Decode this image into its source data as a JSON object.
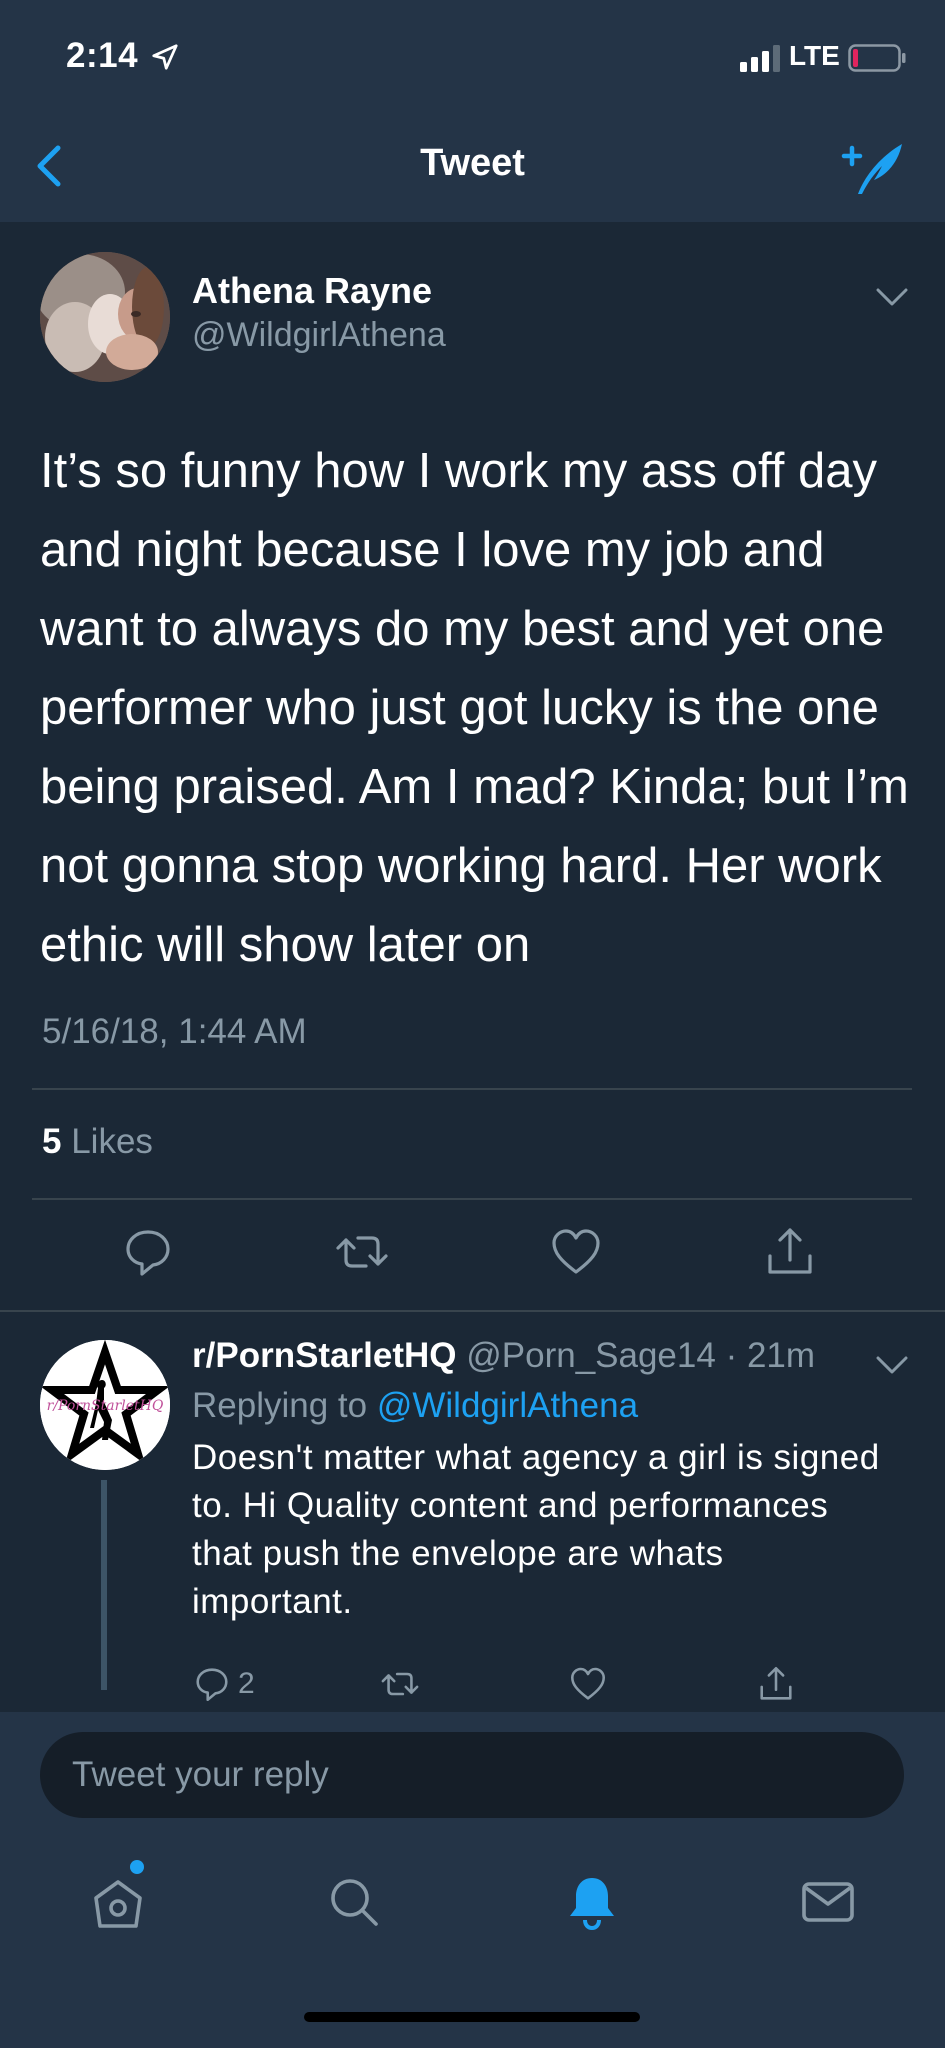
{
  "status_bar": {
    "time": "2:14",
    "network": "LTE",
    "battery_color": "#e0245e"
  },
  "nav": {
    "title": "Tweet"
  },
  "tweet": {
    "author_name": "Athena Rayne",
    "author_handle": "@WildgirlAthena",
    "text": "It’s so funny how I work my ass off day and night because I love my job and want to always do my best and yet one performer who just got lucky is the one being praised. Am I mad? Kinda; but I’m not gonna stop working hard. Her work ethic will show later on",
    "timestamp": "5/16/18, 1:44 AM",
    "likes_count": "5",
    "likes_label": "Likes"
  },
  "reply": {
    "author_name": "r/PornStarletHQ",
    "author_handle": "@Porn_Sage14",
    "separator": " · ",
    "age": "21m",
    "replying_prefix": "Replying to",
    "replying_to": "@WildgirlAthena",
    "text": "Doesn't matter what agency a girl is signed to. Hi Quality content and performances that push the envelope are whats important.",
    "reply_count": "2",
    "avatar_text": "r/PornStarletHQ"
  },
  "composer": {
    "placeholder": "Tweet your reply"
  },
  "tabbar": {
    "items": [
      "home-icon",
      "search-icon",
      "bell-icon",
      "mail-icon"
    ]
  },
  "colors": {
    "accent": "#1da1f2",
    "background": "#1b2836",
    "bar": "#243447",
    "muted": "#8899a6"
  }
}
